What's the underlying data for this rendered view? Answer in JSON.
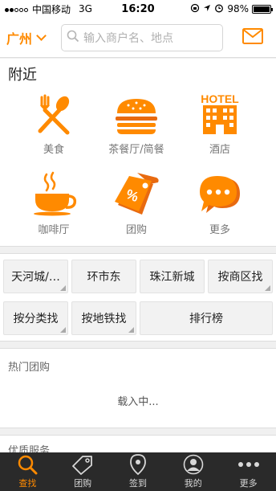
{
  "status_bar": {
    "carrier": "中国移动",
    "network": "3G",
    "time": "16:20",
    "battery": "98%",
    "battery_level": 0.98
  },
  "nav": {
    "city": "广州",
    "search_placeholder": "输入商户名、地点",
    "icons": [
      "chevron-down-icon",
      "search-icon",
      "mail-icon"
    ]
  },
  "nearby": {
    "title": "附近",
    "categories": [
      {
        "label": "美食",
        "icon": "fork-spoon-icon"
      },
      {
        "label": "茶餐厅/简餐",
        "icon": "burger-icon"
      },
      {
        "label": "酒店",
        "icon": "hotel-icon"
      },
      {
        "label": "咖啡厅",
        "icon": "coffee-cup-icon"
      },
      {
        "label": "团购",
        "icon": "price-tag-icon"
      },
      {
        "label": "更多",
        "icon": "more-bubble-icon"
      }
    ],
    "hotel_sign": "HOTEL",
    "tag_symbol": "%"
  },
  "quick_links": [
    "天河城/…",
    "环市东",
    "珠江新城",
    "按商区找",
    "按分类找",
    "按地铁找",
    "排行榜"
  ],
  "hot_deals": {
    "title": "热门团购",
    "loading": "载入中..."
  },
  "quality": {
    "title": "优质服务"
  },
  "tabbar": [
    {
      "label": "查找",
      "icon": "search-icon",
      "active": true
    },
    {
      "label": "团购",
      "icon": "tag-icon",
      "active": false
    },
    {
      "label": "签到",
      "icon": "location-pin-icon",
      "active": false
    },
    {
      "label": "我的",
      "icon": "user-icon",
      "active": false
    },
    {
      "label": "更多",
      "icon": "more-dots-icon",
      "active": false
    }
  ],
  "colors": {
    "accent": "#ff8a00",
    "accent_dark": "#e86a10",
    "tabbar_bg": "#2a2a2a"
  }
}
